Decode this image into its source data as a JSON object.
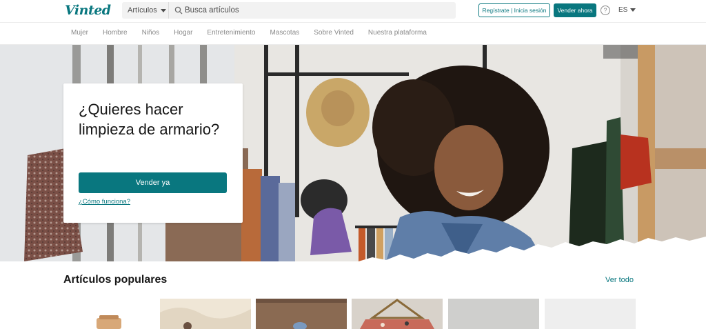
{
  "brand": {
    "logo_text": "Vinted",
    "accent": "#09777f"
  },
  "header": {
    "search_category": "Artículos",
    "search_placeholder": "Busca artículos",
    "register_label": "Regístrate | Inicia sesión",
    "sell_label": "Vender ahora",
    "help_symbol": "?",
    "language": "ES"
  },
  "category_nav": {
    "items": [
      {
        "label": "Mujer"
      },
      {
        "label": "Hombre"
      },
      {
        "label": "Niños"
      },
      {
        "label": "Hogar"
      },
      {
        "label": "Entretenimiento"
      },
      {
        "label": "Mascotas"
      },
      {
        "label": "Sobre Vinted"
      },
      {
        "label": "Nuestra plataforma"
      }
    ]
  },
  "hero": {
    "title": "¿Quieres hacer limpieza de armario?",
    "cta_label": "Vender ya",
    "help_link": "¿Cómo funciona?"
  },
  "popular": {
    "title": "Artículos populares",
    "see_all": "Ver todo"
  }
}
